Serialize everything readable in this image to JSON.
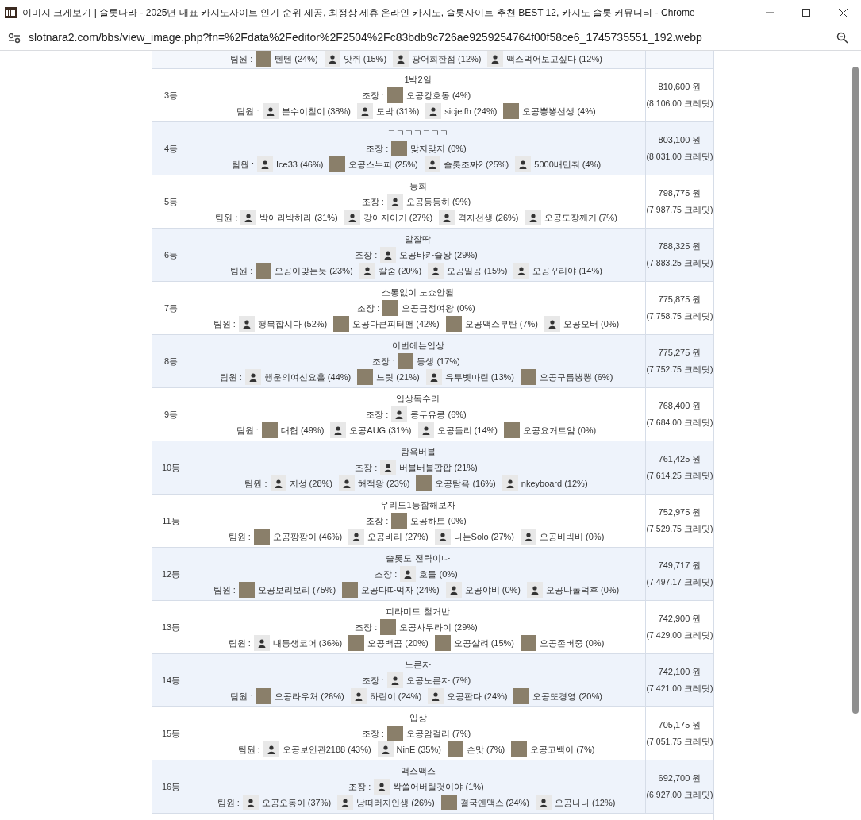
{
  "window": {
    "title": "이미지 크게보기 | 슬롯나라 - 2025년 대표 카지노사이트 인기 순위 제공, 최정상 제휴 온라인 카지노, 슬롯사이트 추천 BEST 12, 카지노 슬롯 커뮤니티 - Chrome",
    "url": "slotnara2.com/bbs/view_image.php?fn=%2Fdata%2Feditor%2F2504%2Fc83bdb9c726ae9259254764f00f58ce6_1745735551_192.webp"
  },
  "partial_row": {
    "members_label": "팀원 :",
    "members": [
      {
        "name": "텐텐 (24%)",
        "kind": "photo"
      },
      {
        "name": "앗쥐 (15%)",
        "kind": "default"
      },
      {
        "name": "광어회한점 (12%)",
        "kind": "default"
      },
      {
        "name": "맥스먹어보고싶다 (12%)",
        "kind": "default"
      }
    ]
  },
  "rows": [
    {
      "rank": "3등",
      "team": "1박2일",
      "leader_label": "조장 :",
      "leader": {
        "name": "오공강호동 (4%)",
        "kind": "photo"
      },
      "members_label": "팀원 :",
      "members": [
        {
          "name": "분수이칠이 (38%)",
          "kind": "default"
        },
        {
          "name": "도박 (31%)",
          "kind": "default"
        },
        {
          "name": "sicjeifh (24%)",
          "kind": "default"
        },
        {
          "name": "오공뽕뽕선생 (4%)",
          "kind": "photo"
        }
      ],
      "amount": "810,600 원",
      "credits": "(8,106.00 크레딧)"
    },
    {
      "rank": "4등",
      "team": "ㄱㄱㄱㄱㄱㄱㄱ",
      "leader_label": "조장 :",
      "leader": {
        "name": "맞지맞지 (0%)",
        "kind": "photo"
      },
      "members_label": "팀원 :",
      "members": [
        {
          "name": "Ice33 (46%)",
          "kind": "default"
        },
        {
          "name": "오공스누피 (25%)",
          "kind": "photo"
        },
        {
          "name": "슬롯조짜2 (25%)",
          "kind": "default"
        },
        {
          "name": "5000배만줘 (4%)",
          "kind": "default"
        }
      ],
      "amount": "803,100 원",
      "credits": "(8,031.00 크레딧)"
    },
    {
      "rank": "5등",
      "team": "등회",
      "leader_label": "조장 :",
      "leader": {
        "name": "오공등등히 (9%)",
        "kind": "default"
      },
      "members_label": "팀원 :",
      "members": [
        {
          "name": "박아라박하라 (31%)",
          "kind": "default"
        },
        {
          "name": "강아지아기 (27%)",
          "kind": "default"
        },
        {
          "name": "격자선생 (26%)",
          "kind": "default"
        },
        {
          "name": "오공도장깨기 (7%)",
          "kind": "default"
        }
      ],
      "amount": "798,775 원",
      "credits": "(7,987.75 크레딧)"
    },
    {
      "rank": "6등",
      "team": "알잘딱",
      "leader_label": "조장 :",
      "leader": {
        "name": "오공바카슬왕 (29%)",
        "kind": "default"
      },
      "members_label": "팀원 :",
      "members": [
        {
          "name": "오공이맞는듯 (23%)",
          "kind": "photo"
        },
        {
          "name": "칼줌 (20%)",
          "kind": "default"
        },
        {
          "name": "오공일공 (15%)",
          "kind": "default"
        },
        {
          "name": "오공꾸리야 (14%)",
          "kind": "default"
        }
      ],
      "amount": "788,325 원",
      "credits": "(7,883.25 크레딧)"
    },
    {
      "rank": "7등",
      "team": "소통없이 노쇼안됨",
      "leader_label": "조장 :",
      "leader": {
        "name": "오공금정여왕 (0%)",
        "kind": "photo"
      },
      "members_label": "팀원 :",
      "members": [
        {
          "name": "행복합시다 (52%)",
          "kind": "default"
        },
        {
          "name": "오공다큰피터팬 (42%)",
          "kind": "photo"
        },
        {
          "name": "오공맥스부탄 (7%)",
          "kind": "photo"
        },
        {
          "name": "오공오버 (0%)",
          "kind": "default"
        }
      ],
      "amount": "775,875 원",
      "credits": "(7,758.75 크레딧)"
    },
    {
      "rank": "8등",
      "team": "이번에는입상",
      "leader_label": "조장 :",
      "leader": {
        "name": "동생 (17%)",
        "kind": "photo"
      },
      "members_label": "팀원 :",
      "members": [
        {
          "name": "행운의여신요홀 (44%)",
          "kind": "default"
        },
        {
          "name": "느릿 (21%)",
          "kind": "photo"
        },
        {
          "name": "유투벳마린 (13%)",
          "kind": "default"
        },
        {
          "name": "오공구름뽕뽕 (6%)",
          "kind": "photo"
        }
      ],
      "amount": "775,275 원",
      "credits": "(7,752.75 크레딧)"
    },
    {
      "rank": "9등",
      "team": "입상독수리",
      "leader_label": "조장 :",
      "leader": {
        "name": "콩두유콩 (6%)",
        "kind": "default"
      },
      "members_label": "팀원 :",
      "members": [
        {
          "name": "대협 (49%)",
          "kind": "photo"
        },
        {
          "name": "오공AUG (31%)",
          "kind": "default"
        },
        {
          "name": "오공둘리 (14%)",
          "kind": "default"
        },
        {
          "name": "오공요거트얌 (0%)",
          "kind": "photo"
        }
      ],
      "amount": "768,400 원",
      "credits": "(7,684.00 크레딧)"
    },
    {
      "rank": "10등",
      "team": "탐욕버블",
      "leader_label": "조장 :",
      "leader": {
        "name": "버블버블팝팝 (21%)",
        "kind": "default"
      },
      "members_label": "팀원 :",
      "members": [
        {
          "name": "지성 (28%)",
          "kind": "default"
        },
        {
          "name": "해적왕 (23%)",
          "kind": "default"
        },
        {
          "name": "오공탐욕 (16%)",
          "kind": "photo"
        },
        {
          "name": "nkeyboard (12%)",
          "kind": "default"
        }
      ],
      "amount": "761,425 원",
      "credits": "(7,614.25 크레딧)"
    },
    {
      "rank": "11등",
      "team": "우리도1등함해보자",
      "leader_label": "조장 :",
      "leader": {
        "name": "오공하트 (0%)",
        "kind": "photo"
      },
      "members_label": "팀원 :",
      "members": [
        {
          "name": "오공팡팡이 (46%)",
          "kind": "photo"
        },
        {
          "name": "오공바리 (27%)",
          "kind": "default"
        },
        {
          "name": "나는Solo (27%)",
          "kind": "default"
        },
        {
          "name": "오공비빅비 (0%)",
          "kind": "default"
        }
      ],
      "amount": "752,975 원",
      "credits": "(7,529.75 크레딧)"
    },
    {
      "rank": "12등",
      "team": "슬롯도 전략이다",
      "leader_label": "조장 :",
      "leader": {
        "name": "호돌 (0%)",
        "kind": "default"
      },
      "members_label": "팀원 :",
      "members": [
        {
          "name": "오공보리보리 (75%)",
          "kind": "photo"
        },
        {
          "name": "오공다따먹자 (24%)",
          "kind": "photo"
        },
        {
          "name": "오공야비 (0%)",
          "kind": "default"
        },
        {
          "name": "오공나폴덕후 (0%)",
          "kind": "default"
        }
      ],
      "amount": "749,717 원",
      "credits": "(7,497.17 크레딧)"
    },
    {
      "rank": "13등",
      "team": "피라미드 철거반",
      "leader_label": "조장 :",
      "leader": {
        "name": "오공사무라이 (29%)",
        "kind": "photo"
      },
      "members_label": "팀원 :",
      "members": [
        {
          "name": "내동생코어 (36%)",
          "kind": "default"
        },
        {
          "name": "오공백곰 (20%)",
          "kind": "photo"
        },
        {
          "name": "오공살려 (15%)",
          "kind": "photo"
        },
        {
          "name": "오공존버중 (0%)",
          "kind": "photo"
        }
      ],
      "amount": "742,900 원",
      "credits": "(7,429.00 크레딧)"
    },
    {
      "rank": "14등",
      "team": "노른자",
      "leader_label": "조장 :",
      "leader": {
        "name": "오공노른자 (7%)",
        "kind": "default"
      },
      "members_label": "팀원 :",
      "members": [
        {
          "name": "오공라우처 (26%)",
          "kind": "photo"
        },
        {
          "name": "하린이 (24%)",
          "kind": "default"
        },
        {
          "name": "오공판다 (24%)",
          "kind": "default"
        },
        {
          "name": "오공또경영 (20%)",
          "kind": "photo"
        }
      ],
      "amount": "742,100 원",
      "credits": "(7,421.00 크레딧)"
    },
    {
      "rank": "15등",
      "team": "입상",
      "leader_label": "조장 :",
      "leader": {
        "name": "오공암걸리 (7%)",
        "kind": "photo"
      },
      "members_label": "팀원 :",
      "members": [
        {
          "name": "오공보안관2188 (43%)",
          "kind": "default"
        },
        {
          "name": "NinE (35%)",
          "kind": "default"
        },
        {
          "name": "손맛 (7%)",
          "kind": "photo"
        },
        {
          "name": "오공고백이 (7%)",
          "kind": "photo"
        }
      ],
      "amount": "705,175 원",
      "credits": "(7,051.75 크레딧)"
    },
    {
      "rank": "16등",
      "team": "맥스맥스",
      "leader_label": "조장 :",
      "leader": {
        "name": "싹쓸어버릴것이야 (1%)",
        "kind": "default"
      },
      "members_label": "팀원 :",
      "members": [
        {
          "name": "오공오동이 (37%)",
          "kind": "default"
        },
        {
          "name": "낭떠러지인생 (26%)",
          "kind": "default"
        },
        {
          "name": "결국엔맥스 (24%)",
          "kind": "photo"
        },
        {
          "name": "오공나나 (12%)",
          "kind": "default"
        }
      ],
      "amount": "692,700 원",
      "credits": "(6,927.00 크레딧)"
    }
  ]
}
